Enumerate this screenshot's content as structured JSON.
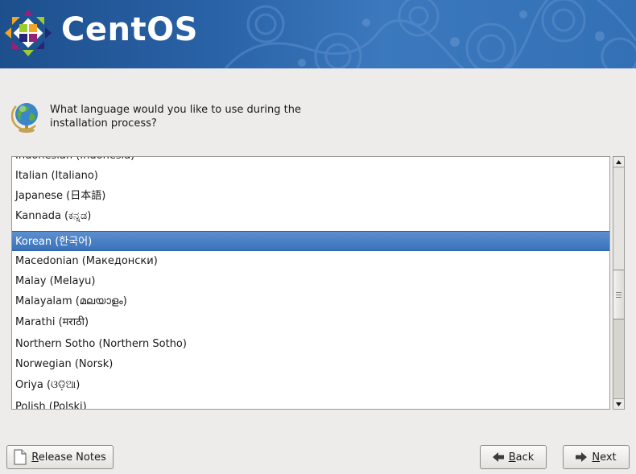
{
  "header": {
    "brand": "CentOS"
  },
  "question": {
    "text": "What language would you like to use during the installation process?"
  },
  "languages": {
    "items": [
      "Indonesian (Indonesia)",
      "Italian (Italiano)",
      "Japanese (日本語)",
      "Kannada (ಕನ್ನಡ)",
      "Korean (한국어)",
      "Macedonian (Македонски)",
      "Malay (Melayu)",
      "Malayalam (മലയാളം)",
      "Marathi (मराठी)",
      "Northern Sotho (Northern Sotho)",
      "Norwegian (Norsk)",
      "Oriya (ଓଡ଼ିଆ)",
      "Polish (Polski)"
    ],
    "selected": "Korean (한국어)"
  },
  "buttons": {
    "release_notes": {
      "mnemonic": "R",
      "rest": "elease Notes"
    },
    "back": {
      "mnemonic": "B",
      "rest": "ack"
    },
    "next": {
      "mnemonic": "N",
      "rest": "ext"
    }
  },
  "colors": {
    "banner": "#2a63a8",
    "selection": "#4a80c4",
    "background": "#edeceb"
  },
  "icons": {
    "logo": "centos-logo-icon",
    "globe": "globe-icon",
    "release_notes": "document-icon",
    "back": "arrow-left-icon",
    "next": "arrow-right-icon"
  }
}
